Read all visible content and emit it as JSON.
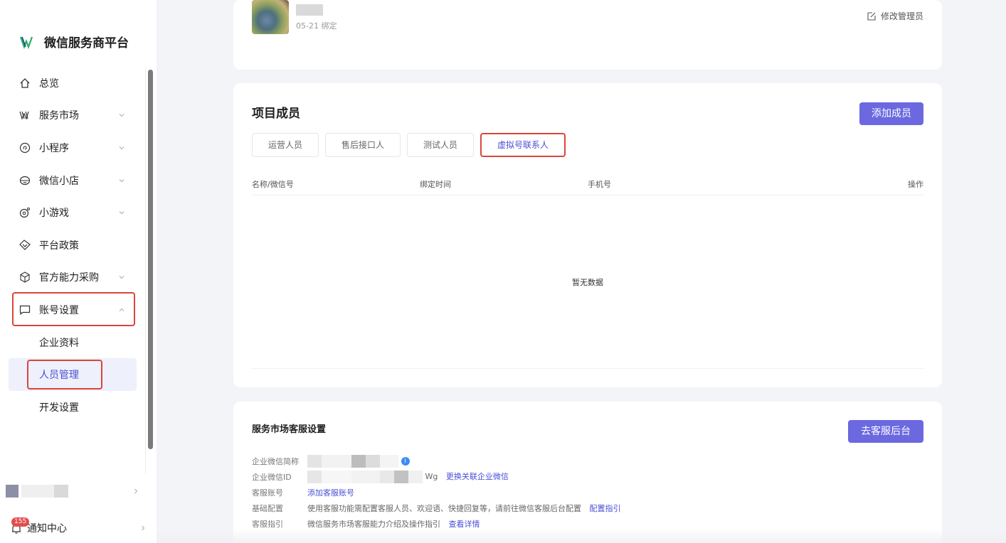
{
  "brand": {
    "name": "微信服务商平台"
  },
  "sidebar": {
    "items": [
      {
        "label": "总览",
        "icon": "home-icon"
      },
      {
        "label": "服务市场",
        "icon": "market-icon"
      },
      {
        "label": "小程序",
        "icon": "miniprogram-icon"
      },
      {
        "label": "微信小店",
        "icon": "shop-icon"
      },
      {
        "label": "小游戏",
        "icon": "game-icon"
      },
      {
        "label": "平台政策",
        "icon": "policy-icon"
      },
      {
        "label": "官方能力采购",
        "icon": "package-icon"
      },
      {
        "label": "账号设置",
        "icon": "account-icon"
      }
    ],
    "sub_items": [
      {
        "label": "企业资料"
      },
      {
        "label": "人员管理"
      },
      {
        "label": "开发设置"
      }
    ],
    "notify": {
      "label": "通知中心",
      "badge": "155"
    }
  },
  "admin_card": {
    "bind_date": "05-21 绑定",
    "edit_label": "修改管理员"
  },
  "members": {
    "title": "项目成员",
    "add_button": "添加成员",
    "tabs": [
      "运营人员",
      "售后接口人",
      "测试人员",
      "虚拟号联系人"
    ],
    "columns": [
      "名称/微信号",
      "绑定时间",
      "手机号",
      "操作"
    ],
    "empty_text": "暂无数据"
  },
  "cs_settings": {
    "title": "服务市场客服设置",
    "button": "去客服后台",
    "rows": {
      "short_name_label": "企业微信简称",
      "id_label": "企业微信ID",
      "id_suffix": "Wg",
      "id_link": "更换关联企业微信",
      "account_label": "客服账号",
      "account_link": "添加客服账号",
      "config_label": "基础配置",
      "config_text": "使用客服功能需配置客服人员、欢迎语、快捷回复等，请前往微信客服后台配置",
      "config_link": "配置指引",
      "guide_label": "客服指引",
      "guide_text": "微信服务市场客服能力介绍及操作指引",
      "guide_link": "查看详情"
    }
  },
  "colors": {
    "accent": "#6b68e0",
    "highlight": "#d9463b",
    "link": "#4a4fd6"
  }
}
